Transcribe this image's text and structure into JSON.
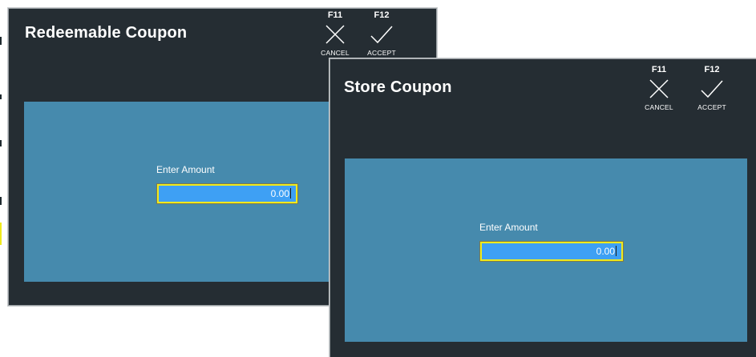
{
  "dialog_redeemable": {
    "title": "Redeemable Coupon",
    "cancel_key": "F11",
    "cancel_label": "CANCEL",
    "cancel_icon": "x-icon",
    "accept_key": "F12",
    "accept_label": "ACCEPT",
    "accept_icon": "check-icon",
    "prompt": "Enter Amount",
    "amount_value": "0.00"
  },
  "dialog_store": {
    "title": "Store Coupon",
    "cancel_key": "F11",
    "cancel_label": "CANCEL",
    "cancel_icon": "x-icon",
    "accept_key": "F12",
    "accept_label": "ACCEPT",
    "accept_icon": "check-icon",
    "prompt": "Enter Amount",
    "amount_value": "0.00"
  },
  "colors": {
    "dialog_bg": "#252d33",
    "panel_bg": "#468aad",
    "field_bg": "#3ea0f4",
    "field_border": "#f0ea1c"
  }
}
